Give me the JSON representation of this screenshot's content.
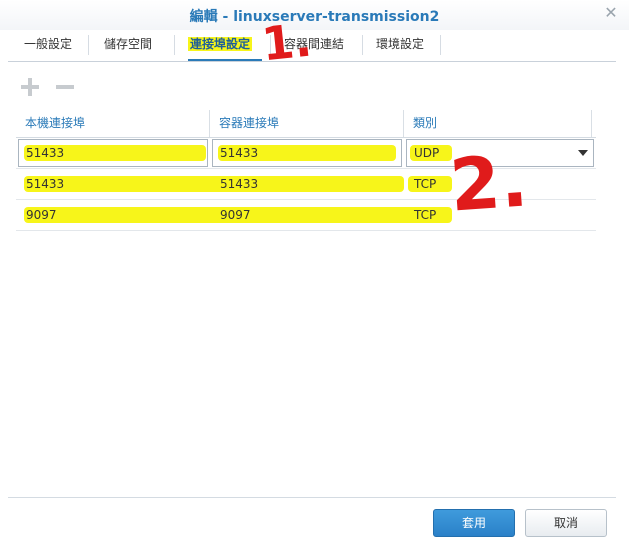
{
  "window": {
    "title": "編輯 - linuxserver-transmission2",
    "close_icon": "close-icon"
  },
  "tabs": [
    {
      "label": "一般設定",
      "active": false
    },
    {
      "label": "儲存空間",
      "active": false
    },
    {
      "label": "連接埠設定",
      "active": true
    },
    {
      "label": "容器間連結",
      "active": false
    },
    {
      "label": "環境設定",
      "active": false
    }
  ],
  "toolbar": {
    "add_icon": "plus-icon",
    "remove_icon": "minus-icon"
  },
  "grid": {
    "columns": [
      "本機連接埠",
      "容器連接埠",
      "類別"
    ],
    "rows": [
      {
        "local": "51433",
        "container": "51433",
        "type": "UDP"
      },
      {
        "local": "51433",
        "container": "51433",
        "type": "TCP"
      },
      {
        "local": "9097",
        "container": "9097",
        "type": "TCP"
      }
    ]
  },
  "annotations": {
    "one": "1.",
    "two": "2."
  },
  "footer": {
    "apply": "套用",
    "cancel": "取消"
  },
  "colors": {
    "accent": "#2a7ab8",
    "highlight": "#f7f51a",
    "annotation": "#e01b1b",
    "primary_button": "#2a80c8"
  }
}
